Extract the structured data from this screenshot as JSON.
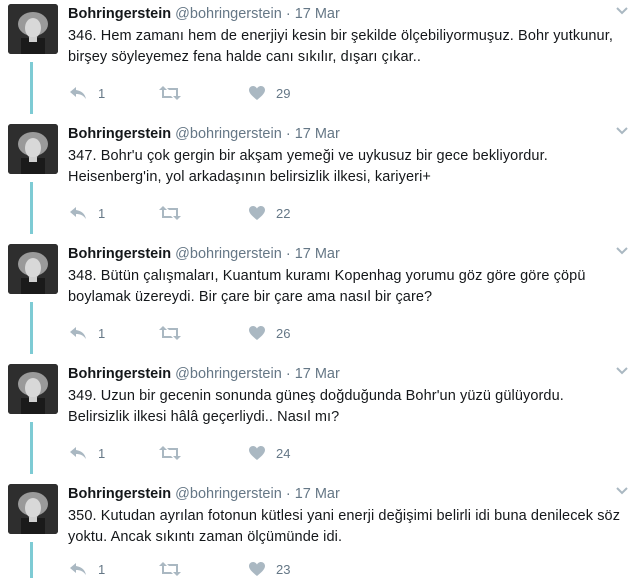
{
  "tweets": [
    {
      "name": "Bohringerstein",
      "handle": "@bohringerstein",
      "dot": "·",
      "time": "17 Mar",
      "text": "346. Hem zamanı hem de enerjiyi kesin bir şekilde ölçebiliyormuşuz. Bohr yutkunur, birşey söyleyemez fena halde canı sıkılır, dışarı çıkar..",
      "replies": "1",
      "likes": "29"
    },
    {
      "name": "Bohringerstein",
      "handle": "@bohringerstein",
      "dot": "·",
      "time": "17 Mar",
      "text": "347. Bohr'u çok gergin bir akşam yemeği ve uykusuz bir gece bekliyordur. Heisenberg'in, yol arkadaşının belirsizlik ilkesi, kariyeri+",
      "replies": "1",
      "likes": "22"
    },
    {
      "name": "Bohringerstein",
      "handle": "@bohringerstein",
      "dot": "·",
      "time": "17 Mar",
      "text": "348. Bütün çalışmaları, Kuantum kuramı Kopenhag yorumu göz göre göre çöpü boylamak üzereydi. Bir çare bir çare ama nasıl bir çare?",
      "replies": "1",
      "likes": "26"
    },
    {
      "name": "Bohringerstein",
      "handle": "@bohringerstein",
      "dot": "·",
      "time": "17 Mar",
      "text": "349. Uzun bir gecenin sonunda güneş doğduğunda Bohr'un yüzü gülüyordu. Belirsizlik ilkesi hâlâ geçerliydi.. Nasıl mı?",
      "replies": "1",
      "likes": "24"
    },
    {
      "name": "Bohringerstein",
      "handle": "@bohringerstein",
      "dot": "·",
      "time": "17 Mar",
      "text": "350. Kutudan ayrılan fotonun kütlesi yani enerji değişimi belirli idi buna denilecek söz yoktu. Ancak sıkıntı zaman ölçümünde idi.",
      "replies": "1",
      "likes": "23"
    }
  ],
  "icons": {
    "reply": "reply-icon",
    "retweet": "retweet-icon",
    "like": "heart-icon",
    "menu": "chevron-down-icon"
  },
  "colors": {
    "thread_line": "#7ecbd4",
    "meta_gray": "#657786",
    "icon_gray": "#aab8c2"
  }
}
